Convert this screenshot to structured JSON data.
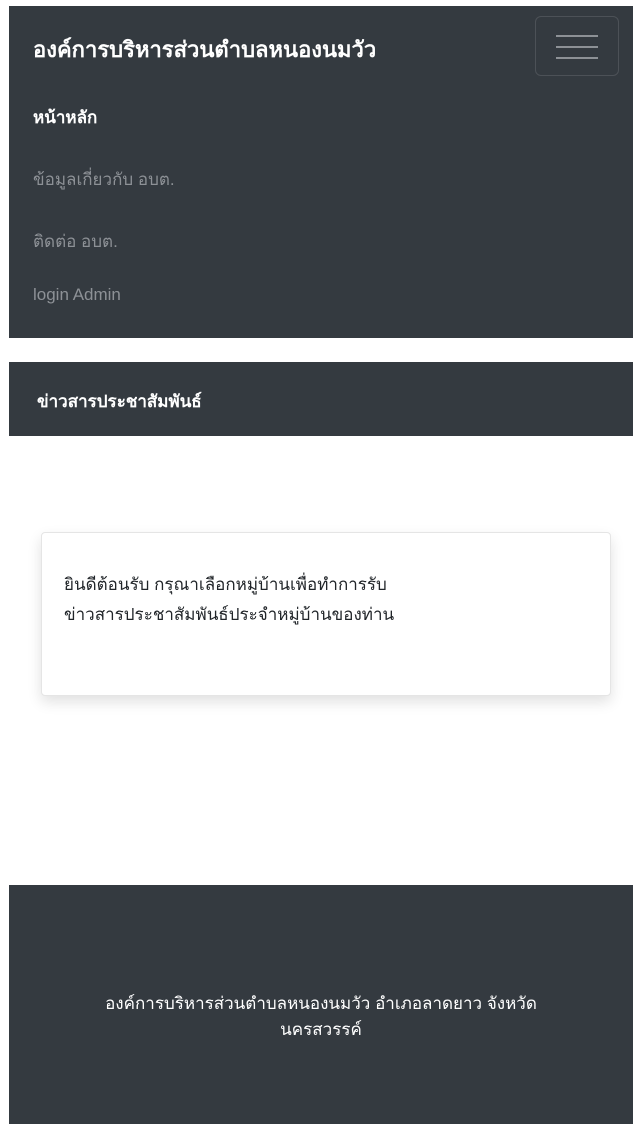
{
  "navbar": {
    "brand": "องค์การบริหารส่วนตำบลหนองนมวัว",
    "toggler_icon": "hamburger-menu-icon",
    "items": [
      {
        "label": "หน้าหลัก"
      },
      {
        "label": "ข้อมูลเกี่ยวกับ อบต."
      },
      {
        "label": "ติดต่อ อบต."
      },
      {
        "label": "login Admin"
      }
    ]
  },
  "section": {
    "title": "ข่าวสารประชาสัมพันธ์"
  },
  "card": {
    "lines": [
      "ยินดีต้อนรับ กรุณาเลือกหมู่บ้านเพื่อทำการรับ",
      "ข่าวสารประชาสัมพันธ์ประจำหมู่บ้านของท่าน"
    ]
  },
  "footer": {
    "lines": [
      "องค์การบริหารส่วนตำบลหนองนมวัว อำเภอลาดยาว จังหวัด",
      "นครสวรรค์"
    ]
  },
  "colors": {
    "dark_bg": "#343a40",
    "muted_text": "#8d9196",
    "white": "#ffffff"
  }
}
